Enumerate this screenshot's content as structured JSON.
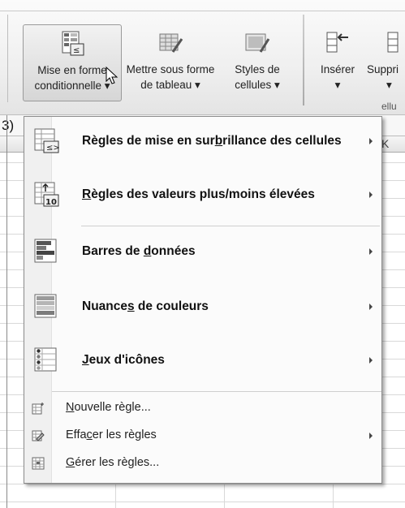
{
  "ribbon": {
    "buttons": [
      {
        "line1": "Mise en forme",
        "line2": "conditionnelle ▾",
        "icon": "conditional-format-icon"
      },
      {
        "line1": "Mettre sous forme",
        "line2": "de tableau ▾",
        "icon": "format-table-icon"
      },
      {
        "line1": "Styles de",
        "line2": "cellules ▾",
        "icon": "cell-styles-icon"
      },
      {
        "line1": "Insérer",
        "line2": "▾",
        "icon": "insert-cells-icon"
      },
      {
        "line1": "Suppri",
        "line2": "▾",
        "icon": "delete-cells-icon"
      }
    ],
    "group_label_cells": "ellu"
  },
  "formula_bar": {
    "text": "3)"
  },
  "sheet": {
    "column_k": "K"
  },
  "menu": {
    "items": [
      {
        "pre": "Règles de mise en sur",
        "u": "b",
        "post": "rillance des cellules",
        "icon": "highlight-rules-icon",
        "submenu": true
      },
      {
        "pre": "",
        "u": "R",
        "post": "ègles des valeurs plus/moins élevées",
        "icon": "top-bottom-rules-icon",
        "submenu": true
      },
      {
        "pre": "Barres de ",
        "u": "d",
        "post": "onnées",
        "icon": "data-bars-icon",
        "submenu": true
      },
      {
        "pre": "Nuance",
        "u": "s",
        "post": " de couleurs",
        "icon": "color-scales-icon",
        "submenu": true
      },
      {
        "pre": "",
        "u": "J",
        "post": "eux d'icônes",
        "icon": "icon-sets-icon",
        "submenu": true
      }
    ],
    "small_items": [
      {
        "pre": "",
        "u": "N",
        "post": "ouvelle règle...",
        "icon": "new-rule-icon",
        "submenu": false
      },
      {
        "pre": "Effa",
        "u": "c",
        "post": "er les règles",
        "icon": "clear-rules-icon",
        "submenu": true
      },
      {
        "pre": "",
        "u": "G",
        "post": "érer les règles...",
        "icon": "manage-rules-icon",
        "submenu": false
      }
    ]
  }
}
